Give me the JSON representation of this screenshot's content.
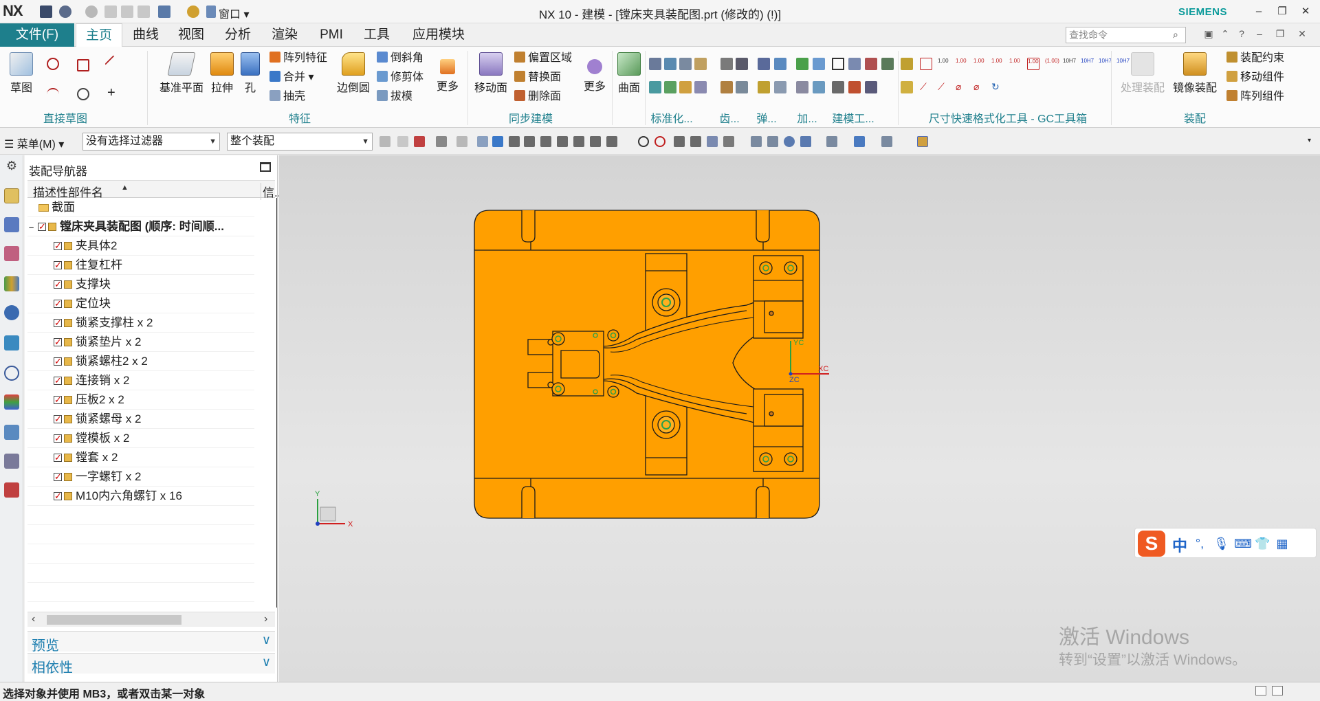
{
  "app": {
    "logo": "NX",
    "window_title": "NX 10 - 建模 - [镗床夹具装配图.prt  (修改的)     (!)]",
    "brand": "SIEMENS",
    "window_controls": [
      "–",
      "❐",
      "✕"
    ]
  },
  "menu_tabs": {
    "file": "文件(F)",
    "tabs": [
      "主页",
      "曲线",
      "视图",
      "分析",
      "渲染",
      "PMI",
      "工具",
      "应用模块"
    ],
    "active": "主页",
    "search_placeholder": "查找命令"
  },
  "ribbon": {
    "groups": {
      "sketch": "直接草图",
      "feature": "特征",
      "sync": "同步建模",
      "standard": "标准化...",
      "gear": "齿...",
      "spring": "弹...",
      "add": "加...",
      "modeling_tools": "建模工...",
      "gc": "尺寸快速格式化工具 - GC工具箱",
      "assembly": "装配"
    },
    "buttons": {
      "sketch": "草图",
      "datum_plane": "基准平面",
      "extrude": "拉伸",
      "hole": "孔",
      "pattern_feature": "阵列特征",
      "unite": "合并",
      "shell": "抽壳",
      "edge_blend": "边倒圆",
      "chamfer": "倒斜角",
      "trim_body": "修剪体",
      "draft": "拔模",
      "more1": "更多",
      "move_face": "移动面",
      "offset_region": "偏置区域",
      "replace_face": "替换面",
      "delete_face": "删除面",
      "more2": "更多",
      "surface": "曲面",
      "process_assembly": "处理装配",
      "mirror_assembly": "镜像装配",
      "assembly_constraint": "装配约束",
      "move_component": "移动组件",
      "pattern_component": "阵列组件"
    }
  },
  "selection_bar": {
    "menu": "菜单(M)",
    "filter": "没有选择过滤器",
    "scope": "整个装配"
  },
  "navigator": {
    "title": "装配导航器",
    "col_name": "描述性部件名",
    "col_info": "信...",
    "section_node": "截面",
    "root": "镗床夹具装配图 (顺序: 时间顺...",
    "parts": [
      "夹具体2",
      "往复杠杆",
      "支撑块",
      "定位块",
      "锁紧支撑柱 x 2",
      "锁紧垫片 x 2",
      "锁紧螺柱2 x 2",
      "连接销 x 2",
      "压板2 x 2",
      "锁紧螺母 x 2",
      "镗模板 x 2",
      "镗套 x 2",
      "一字螺钉 x 2",
      "M10内六角螺钉 x 16"
    ],
    "preview": "预览",
    "dependency": "相依性"
  },
  "viewport": {
    "csys_x": "XC",
    "csys_y": "YC",
    "csys_z": "ZC",
    "mini_x": "X",
    "mini_y": "Y",
    "watermark_title": "激活 Windows",
    "watermark_sub": "转到“设置”以激活 Windows。",
    "colors": {
      "part": "#ff9f00",
      "edge": "#1a1a1a"
    }
  },
  "ime": {
    "logo": "S",
    "mode": "中"
  },
  "status": {
    "message": "选择对象并使用 MB3，或者双击某一对象"
  }
}
